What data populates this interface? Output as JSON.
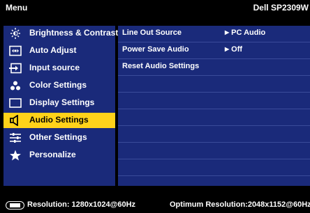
{
  "header": {
    "menu_title": "Menu",
    "model": "Dell SP2309W"
  },
  "sidebar": {
    "items": [
      {
        "label": "Brightness & Contrast",
        "icon": "brightness-icon"
      },
      {
        "label": "Auto Adjust",
        "icon": "auto-adjust-icon"
      },
      {
        "label": "Input source",
        "icon": "input-source-icon"
      },
      {
        "label": "Color Settings",
        "icon": "color-settings-icon"
      },
      {
        "label": "Display Settings",
        "icon": "display-settings-icon"
      },
      {
        "label": "Audio Settings",
        "icon": "speaker-icon",
        "selected": true
      },
      {
        "label": "Other Settings",
        "icon": "other-settings-icon"
      },
      {
        "label": "Personalize",
        "icon": "star-icon"
      }
    ]
  },
  "panel": {
    "rows": [
      {
        "name": "Line Out Source",
        "value": "PC Audio"
      },
      {
        "name": "Power Save Audio",
        "value": "Off"
      },
      {
        "name": "Reset Audio Settings",
        "value": ""
      }
    ]
  },
  "footer": {
    "resolution": "Resolution: 1280x1024@60Hz",
    "optimum": "Optimum Resolution:2048x1152@60Hz"
  },
  "colors": {
    "panel": "#1a2a7a",
    "highlight": "#ffd21a",
    "divider": "#3a4b9a"
  }
}
